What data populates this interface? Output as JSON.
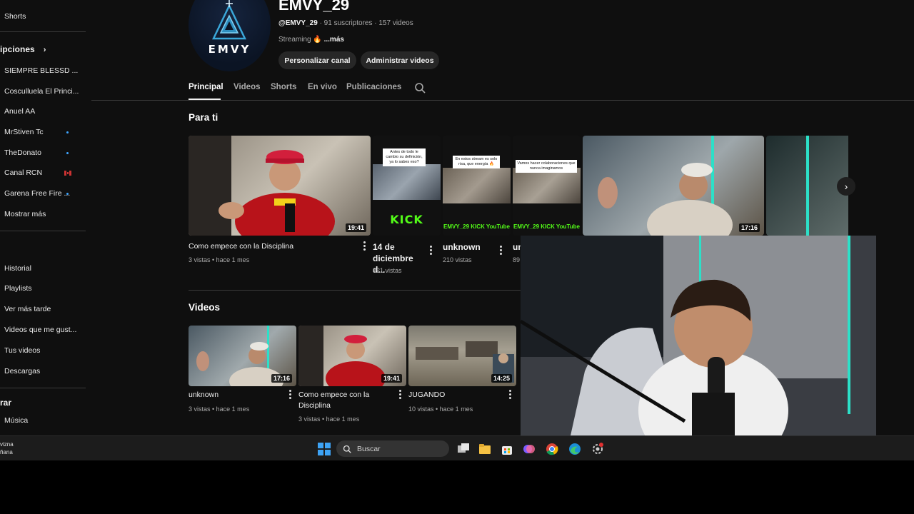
{
  "sidebar": {
    "shorts_label": "Shorts",
    "subscriptions_heading": "ipciones",
    "subscriptions": [
      {
        "label": "SIEMPRE BLESSD ...",
        "indicator": "none"
      },
      {
        "label": "Cosculluela El Princi...",
        "indicator": "none"
      },
      {
        "label": "Anuel AA",
        "indicator": "none"
      },
      {
        "label": "MrStiven Tc",
        "indicator": "dot"
      },
      {
        "label": "TheDonato",
        "indicator": "dot"
      },
      {
        "label": "Canal RCN",
        "indicator": "live"
      },
      {
        "label": "Garena Free Fire ...",
        "indicator": "dot"
      }
    ],
    "show_more": "Mostrar más",
    "you_items": [
      "Historial",
      "Playlists",
      "Ver más tarde",
      "Videos que me gust...",
      "Tus videos",
      "Descargas"
    ],
    "explore_heading": "rar",
    "explore_items": [
      "Música"
    ]
  },
  "channel": {
    "avatar_text": "EMVY",
    "name": "EMVY_29",
    "handle": "@EMVY_29",
    "stats": "· 91 suscriptores · 157 videos",
    "desc_prefix": "Streaming",
    "desc_more": "...más",
    "customize_button": "Personalizar canal",
    "manage_button": "Administrar videos"
  },
  "tabs": [
    "Principal",
    "Videos",
    "Shorts",
    "En vivo",
    "Publicaciones"
  ],
  "for_you": {
    "title": "Para ti",
    "items": [
      {
        "title": "Como empece con la Disciplina",
        "meta": "3 vistas • hace 1 mes",
        "duration": "19:41"
      },
      {
        "title": "14 de diciembre d...",
        "meta": "821 vistas",
        "caption": "Antes de todo le cambio su definición, ya lo sabes eso?"
      },
      {
        "title": "unknown",
        "meta": "210 vistas",
        "caption": "En estos stream es solo risa, que energía 🔥"
      },
      {
        "title": "un",
        "meta": "89",
        "caption": "Vamos hacer colaboraciones que nunca imaginamos"
      },
      {
        "duration": "17:16"
      }
    ],
    "kick_label": "KICK",
    "kick_youtube_label": "EMVY_29 KICK YouTube"
  },
  "videos_section": {
    "title": "Videos",
    "items": [
      {
        "title": "unknown",
        "meta": "3 vistas • hace 1 mes",
        "duration": "17:16"
      },
      {
        "title": "Como empece con la Disciplina",
        "meta": "3 vistas • hace 1 mes",
        "duration": "19:41"
      },
      {
        "title": "JUGANDO",
        "meta": "10 vistas • hace 1 mes",
        "duration": "14:25"
      }
    ]
  },
  "taskbar": {
    "weather_line1": "vizna",
    "weather_line2": "ñana",
    "search_placeholder": "Buscar"
  },
  "colors": {
    "background": "#0f0f0f",
    "kick_green": "#53fc18",
    "subscription_dot": "#3ea6ff",
    "taskbar": "#1c1c1c"
  }
}
